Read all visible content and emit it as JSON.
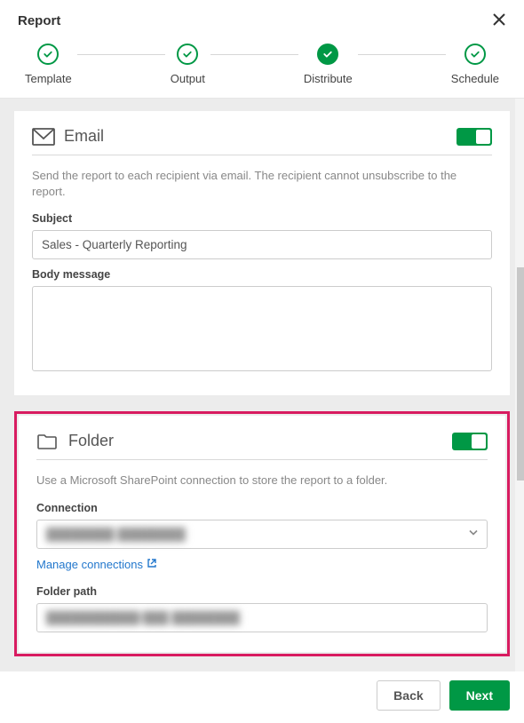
{
  "dialog": {
    "title": "Report"
  },
  "steps": [
    {
      "label": "Template",
      "state": "done-outline"
    },
    {
      "label": "Output",
      "state": "done-outline"
    },
    {
      "label": "Distribute",
      "state": "current-filled"
    },
    {
      "label": "Schedule",
      "state": "done-outline"
    }
  ],
  "email": {
    "title": "Email",
    "description": "Send the report to each recipient via email. The recipient cannot unsubscribe to the report.",
    "subject_label": "Subject",
    "subject_value": "Sales - Quarterly Reporting",
    "body_label": "Body message",
    "body_value": "",
    "enabled": true
  },
  "folder": {
    "title": "Folder",
    "description": "Use a Microsoft SharePoint connection to store the report to a folder.",
    "connection_label": "Connection",
    "connection_value": "████████  ████████",
    "manage_link": "Manage connections",
    "path_label": "Folder path",
    "path_value": "███████████/███  ████████",
    "enabled": true
  },
  "footer": {
    "back": "Back",
    "next": "Next"
  }
}
